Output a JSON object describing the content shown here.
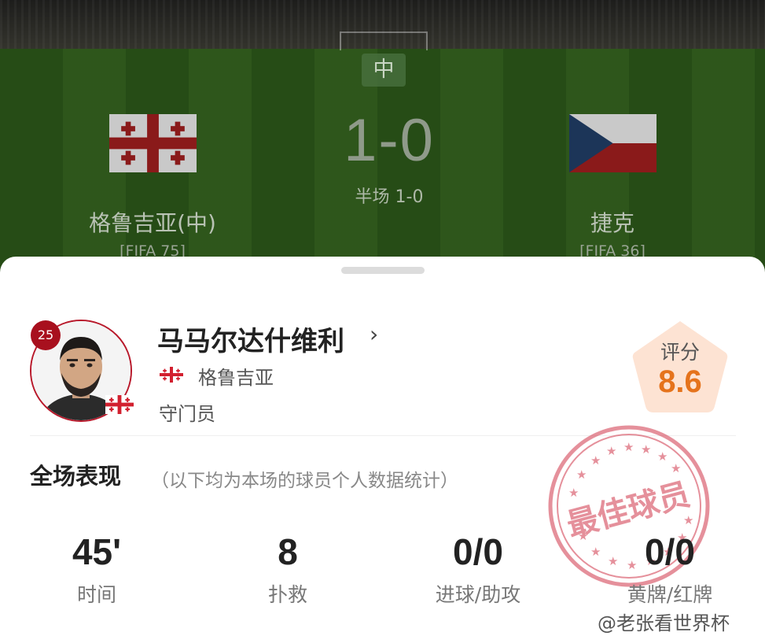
{
  "match": {
    "venue_badge": "中",
    "score": "1-0",
    "halftime": "半场 1-0",
    "home": {
      "name": "格鲁吉亚(中)",
      "rank": "[FIFA 75]"
    },
    "away": {
      "name": "捷克",
      "rank": "[FIFA 36]"
    }
  },
  "player": {
    "number": "25",
    "name": "马马尔达什维利",
    "team": "格鲁吉亚",
    "position": "守门员",
    "rating_label": "评分",
    "rating": "8.6"
  },
  "performance": {
    "title": "全场表现",
    "note": "（以下均为本场的球员个人数据统计）",
    "stats": [
      {
        "value": "45'",
        "label": "时间"
      },
      {
        "value": "8",
        "label": "扑救"
      },
      {
        "value": "0/0",
        "label": "进球/助攻"
      },
      {
        "value": "0/0",
        "label": "黄牌/红牌"
      }
    ]
  },
  "stamp_text": "最佳球员",
  "watermark": "@老张看世界杯",
  "colors": {
    "accent_red": "#b8182a",
    "rating_orange": "#e5731c",
    "rating_bg": "#fde3d3"
  },
  "icons": [
    "georgia-flag",
    "czech-flag",
    "chevron-right-icon",
    "best-player-stamp"
  ]
}
